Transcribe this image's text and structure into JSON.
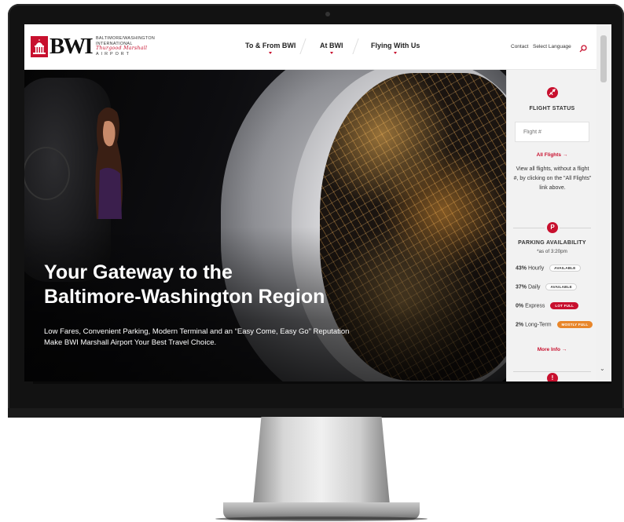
{
  "brand": {
    "logo_text": "BWI",
    "logo_sub_line1": "BALTIMORE/WASHINGTON",
    "logo_sub_line2": "INTERNATIONAL",
    "logo_sub_script": "Thurgood Marshall",
    "logo_sub_line4": "AIRPORT",
    "accent_color": "#c8102e"
  },
  "nav": {
    "items": [
      {
        "label": "To & From BWI"
      },
      {
        "label": "At BWI"
      },
      {
        "label": "Flying With Us"
      }
    ],
    "contact_label": "Contact",
    "language_label": "Select Language"
  },
  "hero": {
    "title_line1": "Your Gateway to the",
    "title_line2": "Baltimore-Washington Region",
    "subtitle_line1": "Low Fares, Convenient Parking, Modern Terminal and an “Easy Come, Easy Go” Reputation",
    "subtitle_line2": "Make BWI Marshall Airport Your Best Travel Choice."
  },
  "flight_status": {
    "heading": "FLIGHT STATUS",
    "input_placeholder": "Flight #",
    "all_flights_link": "All Flights →",
    "help_text": "View all flights, without a flight #, by clicking on the \"All Flights\" link above."
  },
  "parking": {
    "badge": "P",
    "heading": "PARKING AVAILABILITY",
    "timestamp": "*as of 3:20pm",
    "rows": [
      {
        "percent": "43%",
        "name": "Hourly",
        "status": "AVAILABLE",
        "status_type": "available"
      },
      {
        "percent": "37%",
        "name": "Daily",
        "status": "AVAILABLE",
        "status_type": "available"
      },
      {
        "percent": "0%",
        "name": "Express",
        "status": "LOT FULL",
        "status_type": "full"
      },
      {
        "percent": "2%",
        "name": "Long-Term",
        "status": "MOSTLY FULL",
        "status_type": "mostly"
      }
    ],
    "more_info_link": "More Info →"
  },
  "next_badge": "!"
}
